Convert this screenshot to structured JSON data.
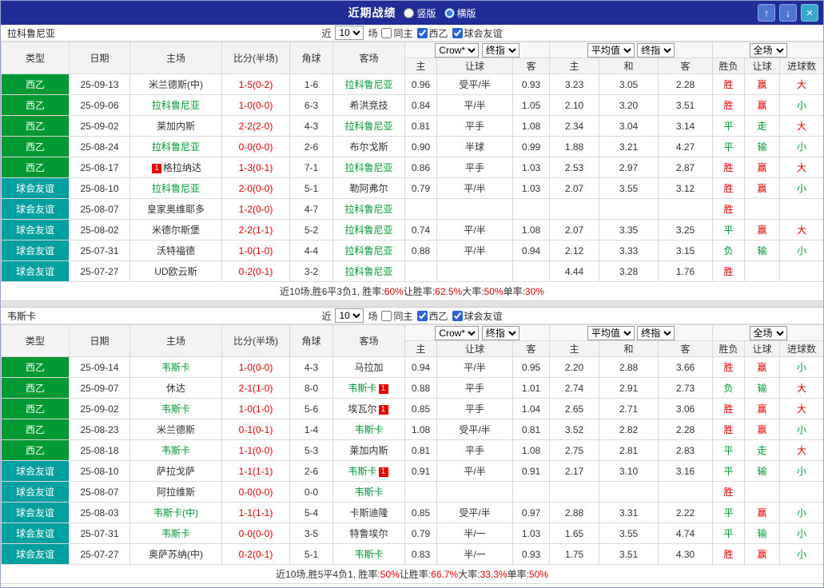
{
  "titlebar": {
    "title": "近期战绩",
    "radios": [
      {
        "label": "竖版",
        "selected": false
      },
      {
        "label": "横版",
        "selected": true
      }
    ],
    "buttons": {
      "up": "↑",
      "down": "↓",
      "close": "×"
    }
  },
  "filter_labels": {
    "near": "近",
    "count": "10",
    "games": "场",
    "same_home": "同主",
    "league": "西乙",
    "friendly": "球会友谊"
  },
  "filter_state": {
    "same_home": false,
    "league": true,
    "friendly": true
  },
  "columns": {
    "type": "类型",
    "date": "日期",
    "home": "主场",
    "score": "比分(半场)",
    "corner": "角球",
    "away": "客场",
    "asia_home": "主",
    "asia_handicap": "让球",
    "asia_away": "客",
    "euro_home": "主",
    "euro_draw": "和",
    "euro_away": "客",
    "result_wdl": "胜负",
    "result_handicap": "让球",
    "result_goals": "进球数"
  },
  "dropdowns": {
    "asia1": "Crow*",
    "asia2": "终指",
    "euro1": "平均值",
    "euro2": "终指",
    "full": "全场"
  },
  "colors": {
    "league_bg": "#009933",
    "friendly_bg": "#00a0a0",
    "team_highlight": "#009933",
    "win_red": "#e60000",
    "lose_green": "#009933",
    "titlebar_bg": "#202d96"
  },
  "tables": [
    {
      "team": "拉科鲁尼亚",
      "rows": [
        {
          "type": "西乙",
          "cls": "league",
          "date": "25-09-13",
          "home": {
            "name": "米兰德斯(中)"
          },
          "score": "1-5(0-2)",
          "corner": "1-6",
          "away": {
            "name": "拉科鲁尼亚",
            "hl": true
          },
          "asia": [
            "0.96",
            "受平/半",
            "0.93"
          ],
          "euro": [
            "3.23",
            "3.05",
            "2.28"
          ],
          "res": [
            [
              "胜",
              "r"
            ],
            [
              "赢",
              "r"
            ],
            [
              "大",
              "r"
            ]
          ]
        },
        {
          "type": "西乙",
          "cls": "league",
          "date": "25-09-06",
          "home": {
            "name": "拉科鲁尼亚",
            "hl": true
          },
          "score": "1-0(0-0)",
          "corner": "6-3",
          "away": {
            "name": "希洪竞技"
          },
          "asia": [
            "0.84",
            "平/半",
            "1.05"
          ],
          "euro": [
            "2.10",
            "3.20",
            "3.51"
          ],
          "res": [
            [
              "胜",
              "r"
            ],
            [
              "赢",
              "r"
            ],
            [
              "小",
              "g"
            ]
          ]
        },
        {
          "type": "西乙",
          "cls": "league",
          "date": "25-09-02",
          "home": {
            "name": "莱加内斯"
          },
          "score": "2-2(2-0)",
          "corner": "4-3",
          "away": {
            "name": "拉科鲁尼亚",
            "hl": true
          },
          "asia": [
            "0.81",
            "平手",
            "1.08"
          ],
          "euro": [
            "2.34",
            "3.04",
            "3.14"
          ],
          "res": [
            [
              "平",
              "g"
            ],
            [
              "走",
              "g"
            ],
            [
              "大",
              "r"
            ]
          ]
        },
        {
          "type": "西乙",
          "cls": "league",
          "date": "25-08-24",
          "home": {
            "name": "拉科鲁尼亚",
            "hl": true
          },
          "score": "0-0(0-0)",
          "corner": "2-6",
          "away": {
            "name": "布尔戈斯"
          },
          "asia": [
            "0.90",
            "半球",
            "0.99"
          ],
          "euro": [
            "1.88",
            "3.21",
            "4.27"
          ],
          "res": [
            [
              "平",
              "g"
            ],
            [
              "输",
              "g"
            ],
            [
              "小",
              "g"
            ]
          ]
        },
        {
          "type": "西乙",
          "cls": "league",
          "date": "25-08-17",
          "home": {
            "name": "格拉纳达",
            "badge": "1",
            "badge_side": "left"
          },
          "score": "1-3(0-1)",
          "corner": "7-1",
          "away": {
            "name": "拉科鲁尼亚",
            "hl": true
          },
          "asia": [
            "0.86",
            "平手",
            "1.03"
          ],
          "euro": [
            "2.53",
            "2.97",
            "2.87"
          ],
          "res": [
            [
              "胜",
              "r"
            ],
            [
              "赢",
              "r"
            ],
            [
              "大",
              "r"
            ]
          ]
        },
        {
          "type": "球会友谊",
          "cls": "friendly",
          "date": "25-08-10",
          "home": {
            "name": "拉科鲁尼亚",
            "hl": true
          },
          "score": "2-0(0-0)",
          "corner": "5-1",
          "away": {
            "name": "勒阿弗尔"
          },
          "asia": [
            "0.79",
            "平/半",
            "1.03"
          ],
          "euro": [
            "2.07",
            "3.55",
            "3.12"
          ],
          "res": [
            [
              "胜",
              "r"
            ],
            [
              "赢",
              "r"
            ],
            [
              "小",
              "g"
            ]
          ]
        },
        {
          "type": "球会友谊",
          "cls": "friendly",
          "date": "25-08-07",
          "home": {
            "name": "皇家奥维耶多"
          },
          "score": "1-2(0-0)",
          "corner": "4-7",
          "away": {
            "name": "拉科鲁尼亚",
            "hl": true
          },
          "asia": [
            "",
            "",
            ""
          ],
          "euro": [
            "",
            "",
            ""
          ],
          "res": [
            [
              "胜",
              "r"
            ],
            [
              "",
              ""
            ],
            [
              "",
              ""
            ]
          ]
        },
        {
          "type": "球会友谊",
          "cls": "friendly",
          "date": "25-08-02",
          "home": {
            "name": "米德尔斯堡"
          },
          "score": "2-2(1-1)",
          "corner": "5-2",
          "away": {
            "name": "拉科鲁尼亚",
            "hl": true
          },
          "asia": [
            "0.74",
            "平/半",
            "1.08"
          ],
          "euro": [
            "2.07",
            "3.35",
            "3.25"
          ],
          "res": [
            [
              "平",
              "g"
            ],
            [
              "赢",
              "r"
            ],
            [
              "大",
              "r"
            ]
          ]
        },
        {
          "type": "球会友谊",
          "cls": "friendly",
          "date": "25-07-31",
          "home": {
            "name": "沃特福德"
          },
          "score": "1-0(1-0)",
          "corner": "4-4",
          "away": {
            "name": "拉科鲁尼亚",
            "hl": true
          },
          "asia": [
            "0.88",
            "平/半",
            "0.94"
          ],
          "euro": [
            "2.12",
            "3.33",
            "3.15"
          ],
          "res": [
            [
              "负",
              "g"
            ],
            [
              "输",
              "g"
            ],
            [
              "小",
              "g"
            ]
          ]
        },
        {
          "type": "球会友谊",
          "cls": "friendly",
          "date": "25-07-27",
          "home": {
            "name": "UD欧云斯"
          },
          "score": "0-2(0-1)",
          "corner": "3-2",
          "away": {
            "name": "拉科鲁尼亚",
            "hl": true
          },
          "asia": [
            "",
            "",
            ""
          ],
          "euro": [
            "4.44",
            "3.28",
            "1.76"
          ],
          "res": [
            [
              "胜",
              "r"
            ],
            [
              "",
              ""
            ],
            [
              "",
              ""
            ]
          ]
        }
      ],
      "summary": [
        [
          "近10场,胜6平3负1, 胜率:",
          false
        ],
        [
          "60%",
          true
        ],
        [
          " 让胜率:",
          false
        ],
        [
          "62.5%",
          true
        ],
        [
          " 大率:",
          false
        ],
        [
          "50%",
          true
        ],
        [
          " 单率:",
          false
        ],
        [
          "30%",
          true
        ]
      ]
    },
    {
      "team": "韦斯卡",
      "rows": [
        {
          "type": "西乙",
          "cls": "league",
          "date": "25-09-14",
          "home": {
            "name": "韦斯卡",
            "hl": true
          },
          "score": "1-0(0-0)",
          "corner": "4-3",
          "away": {
            "name": "马拉加"
          },
          "asia": [
            "0.94",
            "平/半",
            "0.95"
          ],
          "euro": [
            "2.20",
            "2.88",
            "3.66"
          ],
          "res": [
            [
              "胜",
              "r"
            ],
            [
              "赢",
              "r"
            ],
            [
              "小",
              "g"
            ]
          ]
        },
        {
          "type": "西乙",
          "cls": "league",
          "date": "25-09-07",
          "home": {
            "name": "休达"
          },
          "score": "2-1(1-0)",
          "corner": "8-0",
          "away": {
            "name": "韦斯卡",
            "hl": true,
            "badge": "1",
            "badge_side": "right"
          },
          "asia": [
            "0.88",
            "平手",
            "1.01"
          ],
          "euro": [
            "2.74",
            "2.91",
            "2.73"
          ],
          "res": [
            [
              "负",
              "g"
            ],
            [
              "输",
              "g"
            ],
            [
              "大",
              "r"
            ]
          ]
        },
        {
          "type": "西乙",
          "cls": "league",
          "date": "25-09-02",
          "home": {
            "name": "韦斯卡",
            "hl": true
          },
          "score": "1-0(1-0)",
          "corner": "5-6",
          "away": {
            "name": "埃瓦尔",
            "badge": "1",
            "badge_side": "right"
          },
          "asia": [
            "0.85",
            "平手",
            "1.04"
          ],
          "euro": [
            "2.65",
            "2.71",
            "3.06"
          ],
          "res": [
            [
              "胜",
              "r"
            ],
            [
              "赢",
              "r"
            ],
            [
              "大",
              "r"
            ]
          ]
        },
        {
          "type": "西乙",
          "cls": "league",
          "date": "25-08-23",
          "home": {
            "name": "米兰德斯"
          },
          "score": "0-1(0-1)",
          "corner": "1-4",
          "away": {
            "name": "韦斯卡",
            "hl": true
          },
          "asia": [
            "1.08",
            "受平/半",
            "0.81"
          ],
          "euro": [
            "3.52",
            "2.82",
            "2.28"
          ],
          "res": [
            [
              "胜",
              "r"
            ],
            [
              "赢",
              "r"
            ],
            [
              "小",
              "g"
            ]
          ]
        },
        {
          "type": "西乙",
          "cls": "league",
          "date": "25-08-18",
          "home": {
            "name": "韦斯卡",
            "hl": true
          },
          "score": "1-1(0-0)",
          "corner": "5-3",
          "away": {
            "name": "莱加内斯"
          },
          "asia": [
            "0.81",
            "平手",
            "1.08"
          ],
          "euro": [
            "2.75",
            "2.81",
            "2.83"
          ],
          "res": [
            [
              "平",
              "g"
            ],
            [
              "走",
              "g"
            ],
            [
              "大",
              "r"
            ]
          ]
        },
        {
          "type": "球会友谊",
          "cls": "friendly",
          "date": "25-08-10",
          "home": {
            "name": "萨拉戈萨"
          },
          "score": "1-1(1-1)",
          "corner": "2-6",
          "away": {
            "name": "韦斯卡",
            "hl": true,
            "badge": "1",
            "badge_side": "right"
          },
          "asia": [
            "0.91",
            "平/半",
            "0.91"
          ],
          "euro": [
            "2.17",
            "3.10",
            "3.16"
          ],
          "res": [
            [
              "平",
              "g"
            ],
            [
              "输",
              "g"
            ],
            [
              "小",
              "g"
            ]
          ]
        },
        {
          "type": "球会友谊",
          "cls": "friendly",
          "date": "25-08-07",
          "home": {
            "name": "阿拉维斯"
          },
          "score": "0-0(0-0)",
          "corner": "0-0",
          "away": {
            "name": "韦斯卡",
            "hl": true
          },
          "asia": [
            "",
            "",
            ""
          ],
          "euro": [
            "",
            "",
            ""
          ],
          "res": [
            [
              "胜",
              "r"
            ],
            [
              "",
              ""
            ],
            [
              "",
              ""
            ]
          ]
        },
        {
          "type": "球会友谊",
          "cls": "friendly",
          "date": "25-08-03",
          "home": {
            "name": "韦斯卡(中)",
            "hl": true
          },
          "score": "1-1(1-1)",
          "corner": "5-4",
          "away": {
            "name": "卡斯迪隆"
          },
          "asia": [
            "0.85",
            "受平/半",
            "0.97"
          ],
          "euro": [
            "2.88",
            "3.31",
            "2.22"
          ],
          "res": [
            [
              "平",
              "g"
            ],
            [
              "赢",
              "r"
            ],
            [
              "小",
              "g"
            ]
          ]
        },
        {
          "type": "球会友谊",
          "cls": "friendly",
          "date": "25-07-31",
          "home": {
            "name": "韦斯卡",
            "hl": true
          },
          "score": "0-0(0-0)",
          "corner": "3-5",
          "away": {
            "name": "特鲁埃尔"
          },
          "asia": [
            "0.79",
            "半/一",
            "1.03"
          ],
          "euro": [
            "1.65",
            "3.55",
            "4.74"
          ],
          "res": [
            [
              "平",
              "g"
            ],
            [
              "输",
              "g"
            ],
            [
              "小",
              "g"
            ]
          ]
        },
        {
          "type": "球会友谊",
          "cls": "friendly",
          "date": "25-07-27",
          "home": {
            "name": "奥萨苏纳(中)"
          },
          "score": "0-2(0-1)",
          "corner": "5-1",
          "away": {
            "name": "韦斯卡",
            "hl": true
          },
          "asia": [
            "0.83",
            "半/一",
            "0.93"
          ],
          "euro": [
            "1.75",
            "3.51",
            "4.30"
          ],
          "res": [
            [
              "胜",
              "r"
            ],
            [
              "赢",
              "r"
            ],
            [
              "小",
              "g"
            ]
          ]
        }
      ],
      "summary": [
        [
          "近10场,胜5平4负1, 胜率:",
          false
        ],
        [
          "50%",
          true
        ],
        [
          " 让胜率:",
          false
        ],
        [
          "66.7%",
          true
        ],
        [
          " 大率:",
          false
        ],
        [
          "33.3%",
          true
        ],
        [
          " 单率:",
          false
        ],
        [
          "50%",
          true
        ]
      ]
    }
  ]
}
